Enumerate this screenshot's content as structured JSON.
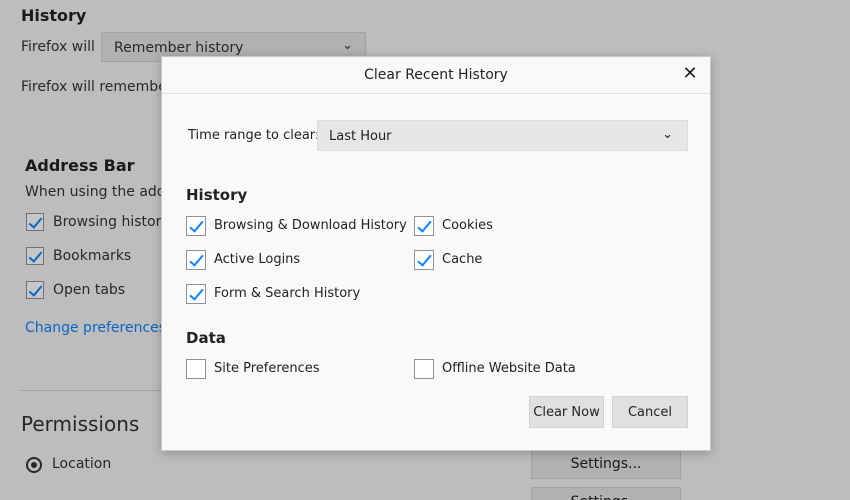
{
  "background": {
    "history_heading": "History",
    "firefox_will_label": "Firefox will",
    "history_mode_value": "Remember history",
    "firefox_will_remember_text": "Firefox will remembe",
    "address_bar_heading": "Address Bar",
    "when_using_text": "When using the addr",
    "checkbox_browsing_history": "Browsing history",
    "checkbox_bookmarks": "Bookmarks",
    "checkbox_open_tabs": "Open tabs",
    "change_preferences_link": "Change preferences",
    "permissions_heading": "Permissions",
    "location_label": "Location",
    "settings_button": "Settings...",
    "second_settings_button": "Settings..."
  },
  "dialog": {
    "title": "Clear Recent History",
    "close_glyph": "✕",
    "time_range_label": "Time range to clear:",
    "time_range_value": "Last Hour",
    "history_heading": "History",
    "history_options": {
      "browsing_download": "Browsing & Download History",
      "cookies": "Cookies",
      "active_logins": "Active Logins",
      "cache": "Cache",
      "form_search": "Form & Search History"
    },
    "data_heading": "Data",
    "data_options": {
      "site_preferences": "Site Preferences",
      "offline_website_data": "Offline Website Data"
    },
    "clear_now_button": "Clear Now",
    "cancel_button": "Cancel",
    "chevron_glyph": "⌄"
  },
  "colors": {
    "accent": "#0a84ff",
    "dialog_bg": "#f9f9fa",
    "page_bg": "#f3f3f3"
  }
}
